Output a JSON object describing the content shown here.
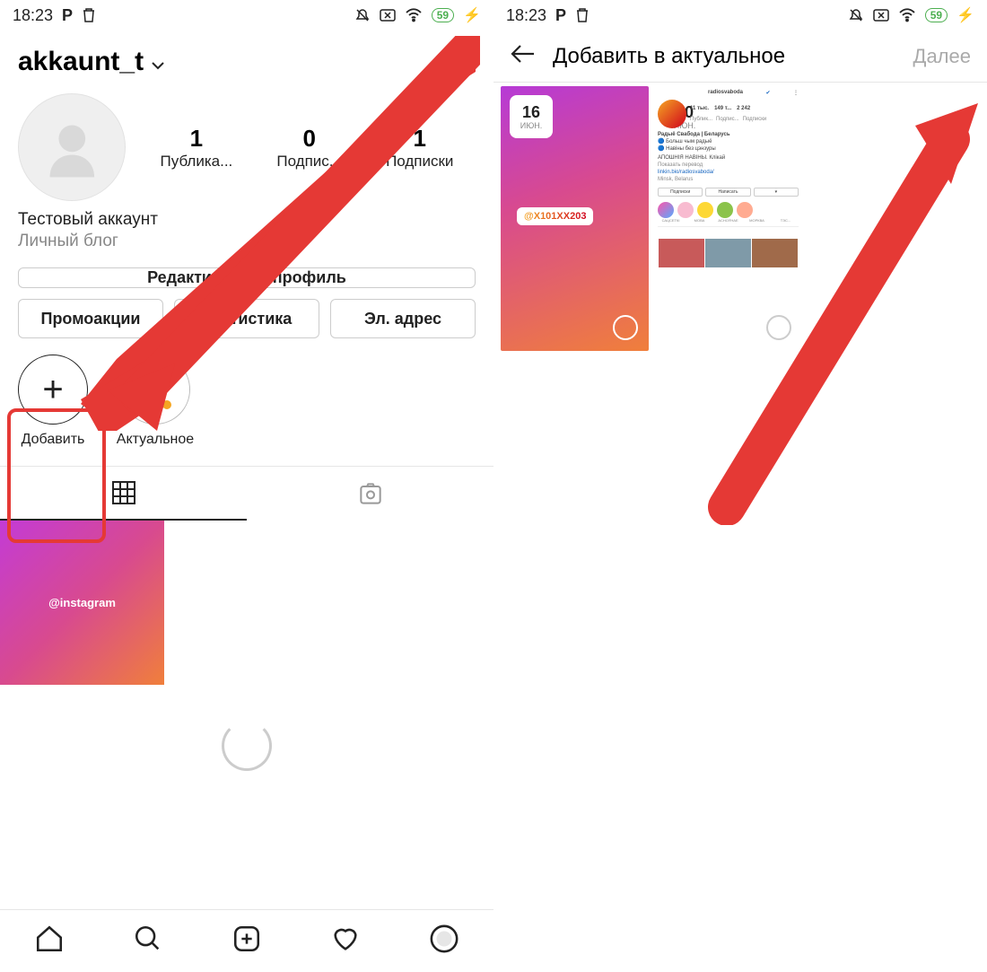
{
  "status": {
    "time": "18:23",
    "battery": "59"
  },
  "left": {
    "username": "akkaunt_t",
    "stats": {
      "posts": {
        "num": "1",
        "lbl": "Публика..."
      },
      "followers": {
        "num": "0",
        "lbl": "Подпис..."
      },
      "following": {
        "num": "1",
        "lbl": "Подписки"
      }
    },
    "name": "Тестовый аккаунт",
    "category": "Личный блог",
    "btn_edit": "Редактировать профиль",
    "btn_promo": "Промоакции",
    "btn_stats": "Статистика",
    "btn_email": "Эл. адрес",
    "hl_add": "Добавить",
    "hl_actual": "Актуальное",
    "post_tag": "@instagram"
  },
  "right": {
    "title": "Добавить в актуальное",
    "next": "Далее",
    "story1": {
      "day": "16",
      "month": "ИЮН.",
      "mention": "@X101XX203"
    },
    "story2": {
      "day": "30",
      "month": "ИЮН.",
      "mini_user": "radiosvaboda",
      "mini_stats": {
        "a": "11 тыс.",
        "b": "149 т...",
        "c": "2 242",
        "la": "Публик...",
        "lb": "Подпис...",
        "lc": "Подписки"
      },
      "mini_name": "Радыё Свабода | Беларусь",
      "mini_line1": "Больш чым радыё",
      "mini_line2": "Навіны без цэнзуры",
      "mini_line3": "АПОШНІЯ НАВІНЫ. Клікай",
      "mini_translate": "Показать перевод",
      "mini_link": "linkin.bio/radiosvaboda/",
      "mini_loc": "Minsk, Belarus",
      "mini_btn1": "Подписки",
      "mini_btn2": "Написать",
      "mini_hl": [
        "САЦСЕТКІ",
        "МОВА",
        "АСНОЎНАЕ",
        "МОРКВА",
        "ТЭС..."
      ]
    }
  }
}
